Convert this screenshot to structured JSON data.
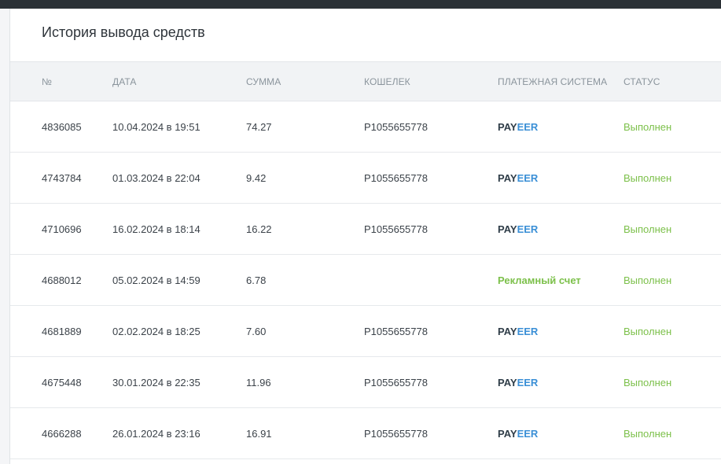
{
  "panel": {
    "title": "История вывода средств"
  },
  "table": {
    "headers": {
      "num": "№",
      "date": "ДАТА",
      "sum": "СУММА",
      "wallet": "КОШЕЛЕК",
      "system": "ПЛАТЕЖНАЯ СИСТЕМА",
      "status": "СТАТУС"
    },
    "rows": [
      {
        "num": "4836085",
        "date": "10.04.2024 в 19:51",
        "sum": "74.27",
        "wallet": "P1055655778",
        "system_a": "PAY",
        "system_b": "EER",
        "system_text": "",
        "status": "Выполнен"
      },
      {
        "num": "4743784",
        "date": "01.03.2024 в 22:04",
        "sum": "9.42",
        "wallet": "P1055655778",
        "system_a": "PAY",
        "system_b": "EER",
        "system_text": "",
        "status": "Выполнен"
      },
      {
        "num": "4710696",
        "date": "16.02.2024 в 18:14",
        "sum": "16.22",
        "wallet": "P1055655778",
        "system_a": "PAY",
        "system_b": "EER",
        "system_text": "",
        "status": "Выполнен"
      },
      {
        "num": "4688012",
        "date": "05.02.2024 в 14:59",
        "sum": "6.78",
        "wallet": "",
        "system_a": "",
        "system_b": "",
        "system_text": "Рекламный счет",
        "status": "Выполнен"
      },
      {
        "num": "4681889",
        "date": "02.02.2024 в 18:25",
        "sum": "7.60",
        "wallet": "P1055655778",
        "system_a": "PAY",
        "system_b": "EER",
        "system_text": "",
        "status": "Выполнен"
      },
      {
        "num": "4675448",
        "date": "30.01.2024 в 22:35",
        "sum": "11.96",
        "wallet": "P1055655778",
        "system_a": "PAY",
        "system_b": "EER",
        "system_text": "",
        "status": "Выполнен"
      },
      {
        "num": "4666288",
        "date": "26.01.2024 в 23:16",
        "sum": "16.91",
        "wallet": "P1055655778",
        "system_a": "PAY",
        "system_b": "EER",
        "system_text": "",
        "status": "Выполнен"
      }
    ]
  },
  "colors": {
    "status_done": "#7cc04a",
    "payeer_dark": "#2f3d48",
    "payeer_blue": "#3a8fd6",
    "topbar": "#2b3136"
  }
}
